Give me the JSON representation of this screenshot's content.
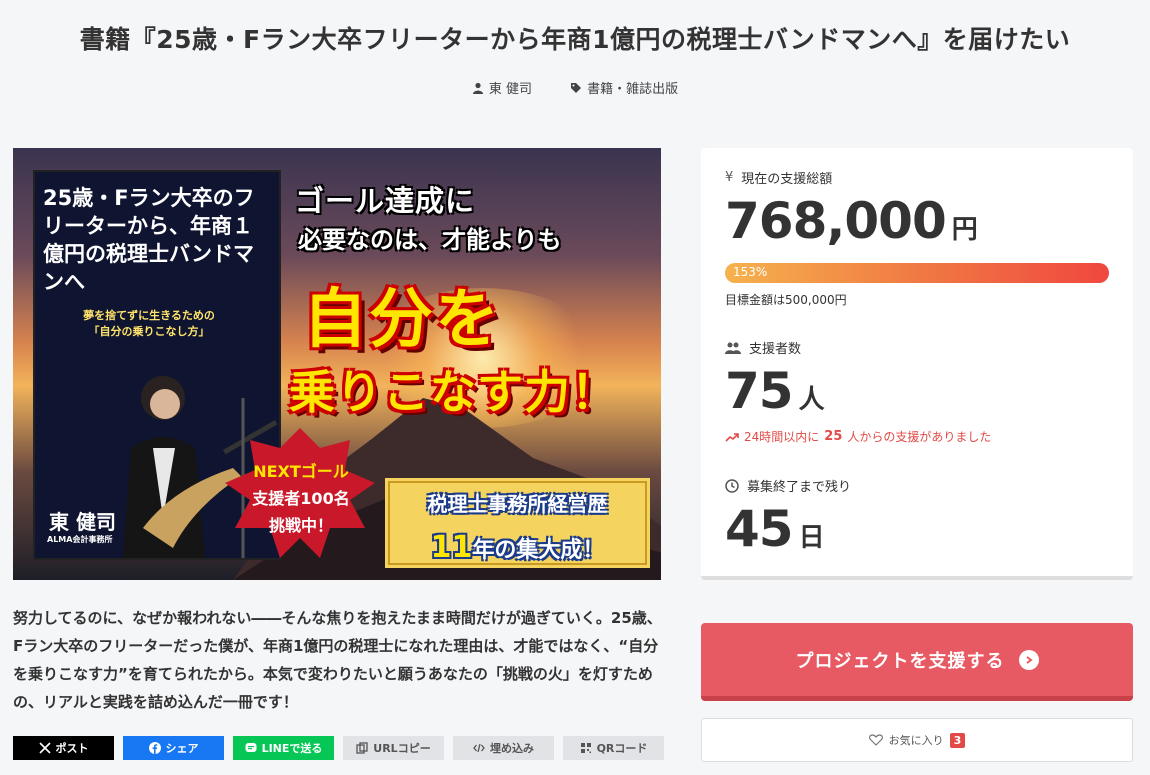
{
  "page": {
    "title": "書籍『25歳・Fラン大卒フリーターから年商1億円の税理士バンドマンへ』を届けたい",
    "author": "東 健司",
    "category": "書籍・雑誌出版"
  },
  "hero": {
    "left_title": "25歳・Fラン大卒のフリーターから、年商１億円の税理士バンドマンへ",
    "left_sub_1": "夢を捨てずに生きるための",
    "left_sub_2": "「自分の乗りこなし方」",
    "left_name": "東 健司",
    "left_company": "ALMA会計事務所",
    "headline_1": "ゴール達成に",
    "headline_2": "必要なのは、才能よりも",
    "big_1": "自分を",
    "big_2": "乗りこなす力！",
    "badge_1": "NEXTゴール",
    "badge_2": "支援者100名",
    "badge_3": "挑戦中！",
    "banner_1": "税理士事務所経営歴",
    "banner_num": "11",
    "banner_2": "年の集大成！"
  },
  "description": "努力してるのに、なぜか報われない――そんな焦りを抱えたまま時間だけが過ぎていく。25歳、Fラン大卒のフリーターだった僕が、年商1億円の税理士になれた理由は、才能ではなく、“自分を乗りこなす力”を育てられたから。本気で変わりたいと願うあなたの「挑戦の火」を灯すための、リアルと実践を詰め込んだ一冊です！",
  "share": {
    "x": "ポスト",
    "facebook": "シェア",
    "line": "LINEで送る",
    "url": "URLコピー",
    "embed": "埋め込み",
    "qr": "QRコード"
  },
  "stats": {
    "total_label": "現在の支援総額",
    "total_value": "768,000",
    "total_unit": "円",
    "progress_text": "153%",
    "progress_fraction": 1.53,
    "goal_text": "目標金額は500,000円",
    "supporters_label": "支援者数",
    "supporters_value": "75",
    "supporters_unit": "人",
    "recent_prefix": "24時間以内に",
    "recent_count": "25",
    "recent_suffix": "人からの支援がありました",
    "remaining_label": "募集終了まで残り",
    "remaining_value": "45",
    "remaining_unit": "日"
  },
  "actions": {
    "support_label": "プロジェクトを支援する",
    "favorite_label": "お気に入り",
    "favorite_count": "3"
  },
  "colors": {
    "accent": "#e85a63",
    "alert": "#e24a47",
    "x": "#000000",
    "facebook": "#1877f2",
    "line": "#06c755"
  }
}
